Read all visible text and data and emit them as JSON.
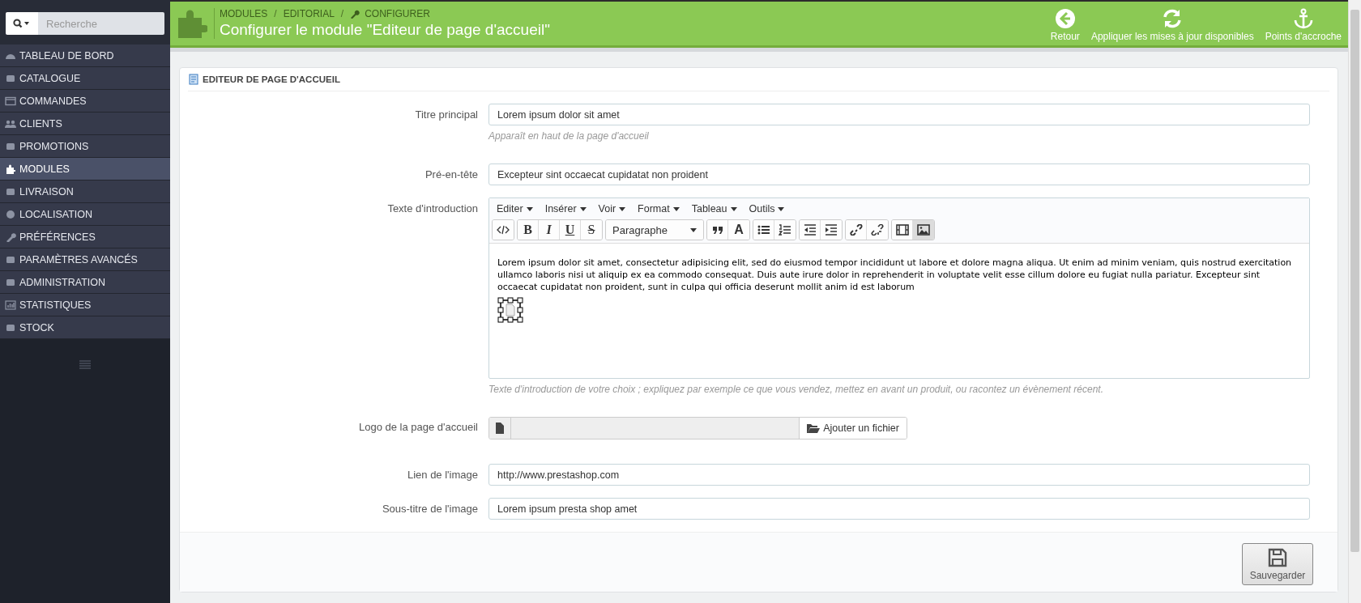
{
  "search": {
    "placeholder": "Recherche"
  },
  "sidebar": {
    "items": [
      {
        "label": "TABLEAU DE BORD",
        "selected": false
      },
      {
        "label": "CATALOGUE",
        "selected": false
      },
      {
        "label": "COMMANDES",
        "selected": false
      },
      {
        "label": "CLIENTS",
        "selected": false
      },
      {
        "label": "PROMOTIONS",
        "selected": false
      },
      {
        "label": "MODULES",
        "selected": true
      },
      {
        "label": "LIVRAISON",
        "selected": false
      },
      {
        "label": "LOCALISATION",
        "selected": false
      },
      {
        "label": "PRÉFÉRENCES",
        "selected": false
      },
      {
        "label": "PARAMÈTRES AVANCÉS",
        "selected": false
      },
      {
        "label": "ADMINISTRATION",
        "selected": false
      },
      {
        "label": "STATISTIQUES",
        "selected": false
      },
      {
        "label": "STOCK",
        "selected": false
      }
    ]
  },
  "header": {
    "breadcrumb": [
      "MODULES",
      "EDITORIAL",
      "CONFIGURER"
    ],
    "separator": "/",
    "title": "Configurer le module \"Editeur de page d'accueil\"",
    "actions": [
      {
        "label": "Retour"
      },
      {
        "label": "Appliquer les mises à jour disponibles"
      },
      {
        "label": "Points d'accroche"
      }
    ]
  },
  "panel": {
    "heading": "EDITEUR DE PAGE D'ACCUEIL",
    "fields": [
      {
        "kind": "text",
        "label": "Titre principal",
        "value": "Lorem ipsum dolor sit amet",
        "help": "Apparaît en haut de la page d'accueil"
      },
      {
        "kind": "text",
        "label": "Pré-en-tête",
        "value": "Excepteur sint occaecat cupidatat non proident"
      },
      {
        "kind": "editor",
        "label": "Texte d'introduction",
        "help": "Texte d'introduction de votre choix ; expliquez par exemple ce que vous vendez, mettez en avant un produit, ou racontez un évènement récent.",
        "menus": [
          "Editer",
          "Insérer",
          "Voir",
          "Format",
          "Tableau",
          "Outils"
        ],
        "toolbar": [
          [
            {
              "kind": "code",
              "pressed": false
            }
          ],
          [
            {
              "kind": "bold",
              "label": "B",
              "pressed": false
            },
            {
              "kind": "italic",
              "label": "I",
              "pressed": false
            },
            {
              "kind": "underline",
              "label": "U",
              "pressed": false
            },
            {
              "kind": "strike",
              "label": "S",
              "pressed": false
            }
          ],
          [
            {
              "kind": "select",
              "label": "Paragraphe",
              "pressed": false
            }
          ],
          [
            {
              "kind": "quote",
              "pressed": false
            },
            {
              "kind": "color",
              "label": "A",
              "pressed": false
            }
          ],
          [
            {
              "kind": "bullets",
              "pressed": false
            },
            {
              "kind": "numbers",
              "pressed": false
            }
          ],
          [
            {
              "kind": "outdent",
              "pressed": false
            },
            {
              "kind": "indent",
              "pressed": false
            }
          ],
          [
            {
              "kind": "link",
              "pressed": false
            },
            {
              "kind": "unlink",
              "pressed": false
            }
          ],
          [
            {
              "kind": "video",
              "pressed": false
            },
            {
              "kind": "image",
              "pressed": true
            }
          ]
        ],
        "content": "Lorem ipsum dolor sit amet, consectetur adipisicing elit, sed do eiusmod tempor incididunt ut labore et dolore magna aliqua. Ut enim ad minim veniam, quis nostrud exercitation ullamco laboris nisi ut aliquip ex ea commodo consequat. Duis aute irure dolor in reprehenderit in voluptate velit esse cillum dolore eu fugiat nulla pariatur. Excepteur sint occaecat cupidatat non proident, sunt in culpa qui officia deserunt mollit anim id est laborum"
      },
      {
        "kind": "file",
        "label": "Logo de la page d'accueil",
        "button": "Ajouter un fichier"
      },
      {
        "kind": "text",
        "label": "Lien de l'image",
        "value": "http://www.prestashop.com"
      },
      {
        "kind": "text",
        "label": "Sous-titre de l'image",
        "value": "Lorem ipsum presta shop amet"
      }
    ],
    "save": "Sauvegarder"
  }
}
